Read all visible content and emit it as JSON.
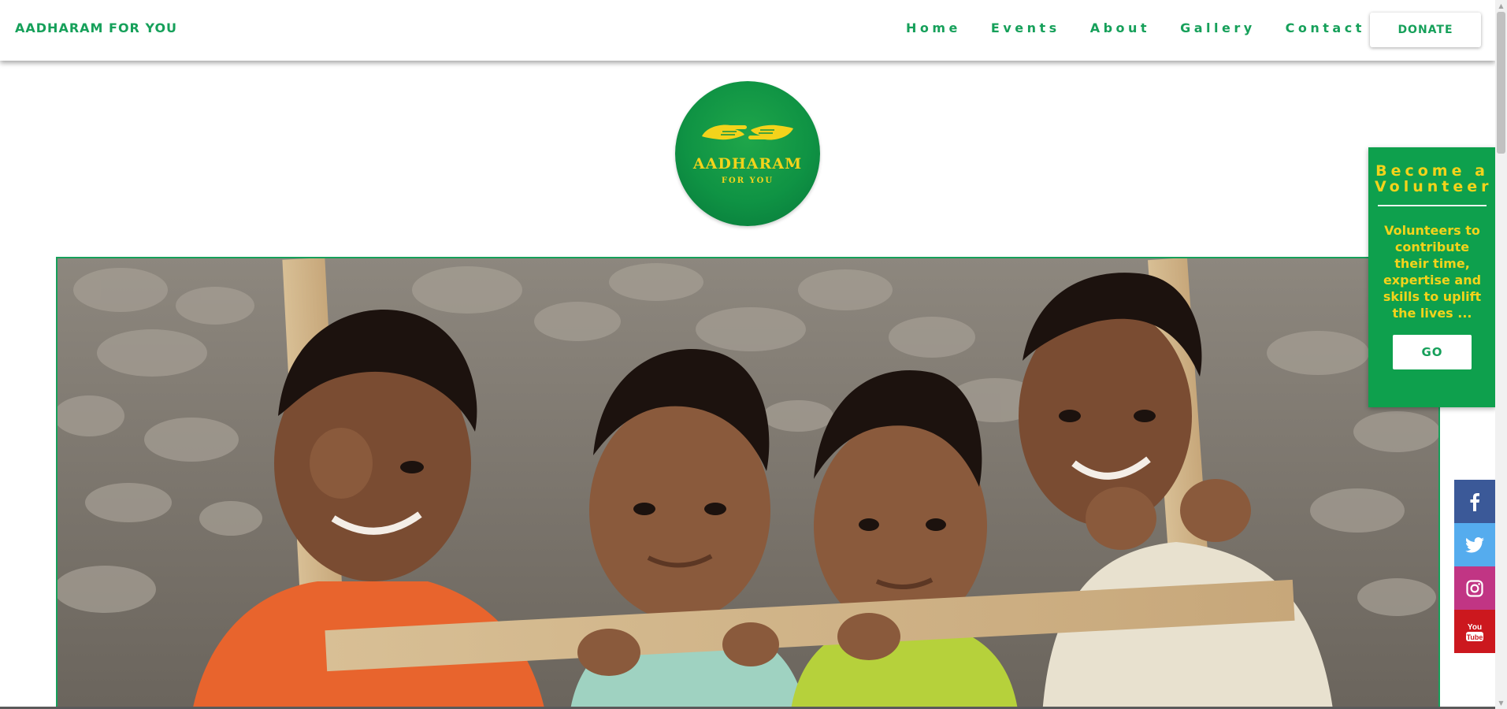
{
  "nav": {
    "brand": "AADHARAM FOR YOU",
    "links": [
      "Home",
      "Events",
      "About",
      "Gallery",
      "Contact"
    ],
    "donate_label": "DONATE"
  },
  "logo": {
    "title": "AADHARAM",
    "subtitle": "FOR YOU"
  },
  "volunteer": {
    "title": "Become a Volunteer",
    "text": "Volunteers to contribute their time, expertise and skills to uplift the lives ...",
    "button_label": "GO"
  },
  "social": {
    "items": [
      {
        "name": "facebook",
        "icon": "facebook-icon",
        "color": "#3b5998"
      },
      {
        "name": "twitter",
        "icon": "twitter-icon",
        "color": "#55acee"
      },
      {
        "name": "instagram",
        "icon": "instagram-icon",
        "color": "#c13584"
      },
      {
        "name": "youtube",
        "icon": "youtube-icon",
        "color": "#cc181e"
      }
    ]
  },
  "colors": {
    "brand_green": "#16a05a",
    "accent_yellow": "#f3d31b"
  }
}
